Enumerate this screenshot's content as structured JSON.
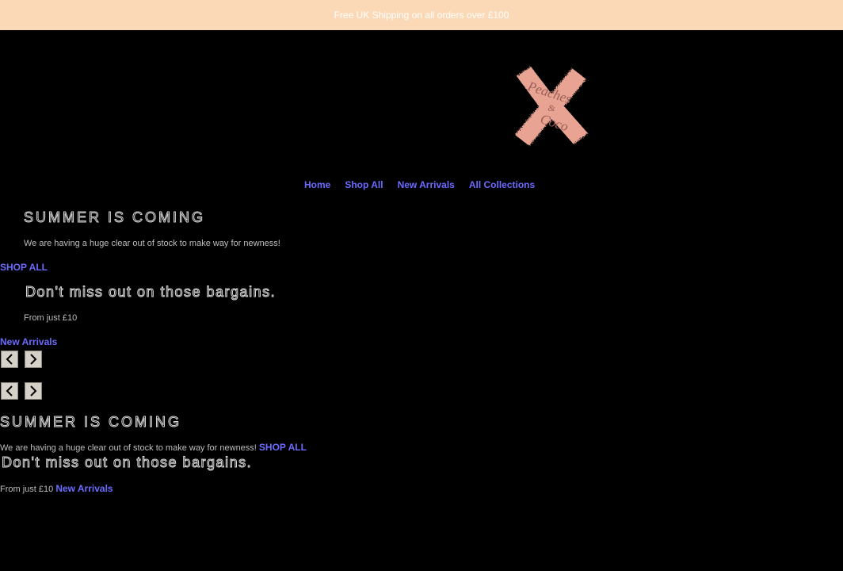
{
  "announcement": {
    "text": "Free UK Shipping on all orders over £100"
  },
  "logo": {
    "alt_text": "Peaches & Coco",
    "colors": {
      "pink": "#e8a393",
      "text": "#9b5f55"
    }
  },
  "nav": {
    "items": [
      {
        "label": "Home"
      },
      {
        "label": "Shop All"
      },
      {
        "label": "New Arrivals"
      },
      {
        "label": "All Collections"
      }
    ]
  },
  "slider": {
    "slides": [
      {
        "heading": "SUMMER IS COMING",
        "text": "We are having a huge clear out of stock to make way for newness!",
        "button": "SHOP ALL"
      },
      {
        "heading": "Don't miss out on those bargains.",
        "text": "From just £10",
        "button": "New Arrivals"
      }
    ],
    "controls": {
      "prev": "previous",
      "next": "next"
    }
  },
  "fallback": {
    "slides": [
      {
        "heading": "SUMMER IS COMING",
        "text": "We are having a huge clear out of stock to make way for newness!",
        "button": "SHOP ALL"
      },
      {
        "heading": "Don't miss out on those bargains.",
        "text": "From just £10",
        "button": "New Arrivals"
      }
    ]
  },
  "colors": {
    "banner": "#fcd9b6",
    "link": "#6b6bff",
    "background": "#000000"
  }
}
